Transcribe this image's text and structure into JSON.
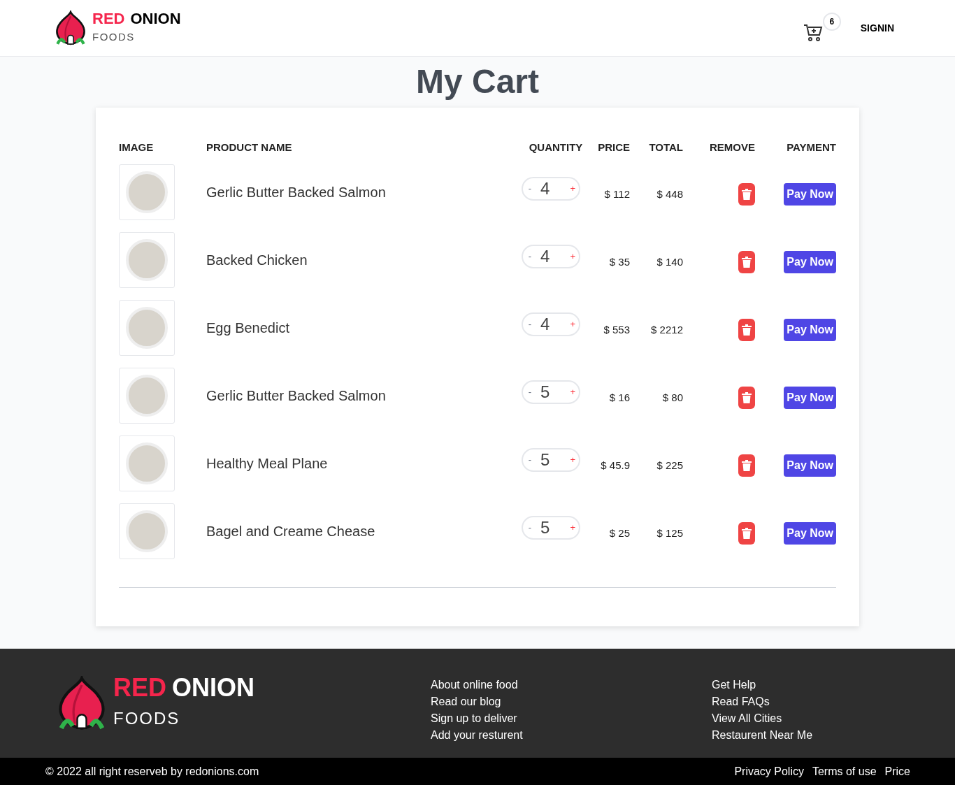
{
  "header": {
    "logo": {
      "brand_red": "RED",
      "brand_rest": "ONION",
      "sub": "FOODS"
    },
    "cart_count": "6",
    "signin": "SIGNIN"
  },
  "title": "My Cart",
  "table": {
    "columns": [
      "IMAGE",
      "PRODUCT NAME",
      "QUANTITY",
      "PRICE",
      "TOTAL",
      "REMOVE",
      "PAYMENT"
    ],
    "rows": [
      {
        "name": "Gerlic Butter Backed Salmon",
        "minus": "-",
        "quantity": "4",
        "plus": "+",
        "price": "$ 112",
        "total": "$ 448",
        "pay": "Pay Now"
      },
      {
        "name": "Backed Chicken",
        "minus": "-",
        "quantity": "4",
        "plus": "+",
        "price": "$ 35",
        "total": "$ 140",
        "pay": "Pay Now"
      },
      {
        "name": "Egg Benedict",
        "minus": "-",
        "quantity": "4",
        "plus": "+",
        "price": "$ 553",
        "total": "$ 2212",
        "pay": "Pay Now"
      },
      {
        "name": "Gerlic Butter Backed Salmon",
        "minus": "-",
        "quantity": "5",
        "plus": "+",
        "price": "$ 16",
        "total": "$ 80",
        "pay": "Pay Now"
      },
      {
        "name": "Healthy Meal Plane",
        "minus": "-",
        "quantity": "5",
        "plus": "+",
        "price": "$ 45.9",
        "total": "$ 225",
        "pay": "Pay Now"
      },
      {
        "name": "Bagel and Creame Chease",
        "minus": "-",
        "quantity": "5",
        "plus": "+",
        "price": "$ 25",
        "total": "$ 125",
        "pay": "Pay Now"
      }
    ]
  },
  "footer": {
    "logo": {
      "brand_red": "RED",
      "brand_rest": "ONION",
      "sub": "FOODS"
    },
    "links_1": [
      "About online food",
      "Read our blog",
      "Sign up to deliver",
      "Add your resturent"
    ],
    "links_2": [
      "Get Help",
      "Read FAQs",
      "View All Cities",
      "Restaurent Near Me"
    ],
    "copyright": "© 2022 all right reserveb by redonions.com",
    "bottom_links": [
      "Privacy Policy",
      "Terms of use",
      "Price"
    ]
  }
}
